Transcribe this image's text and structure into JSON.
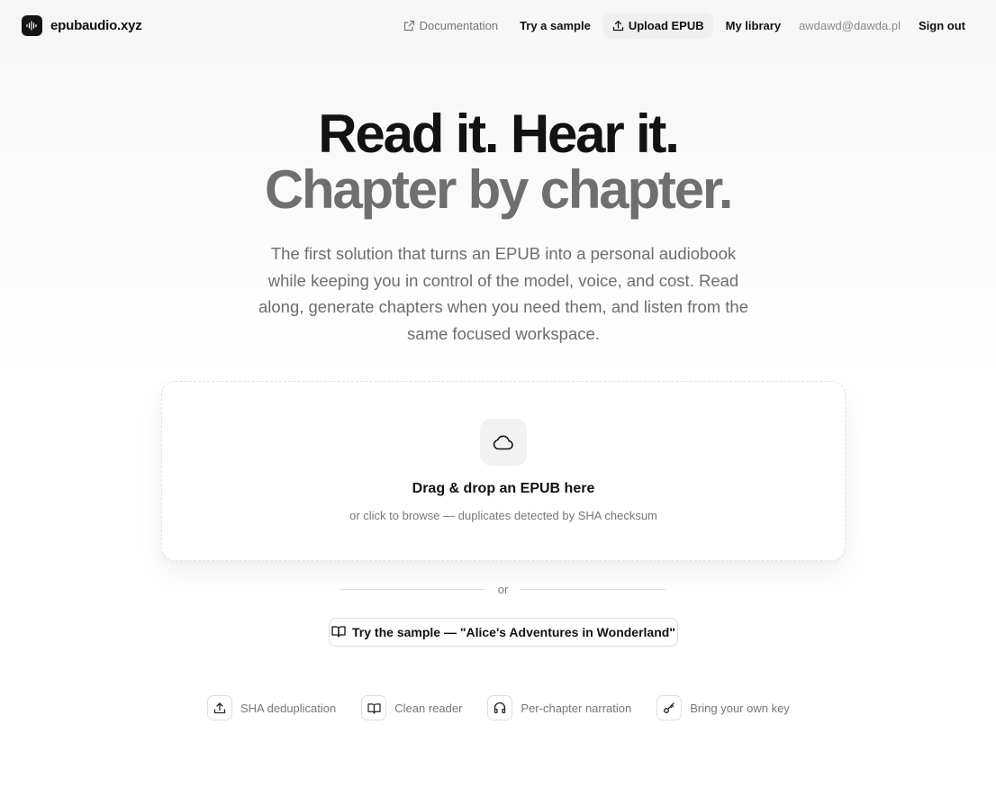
{
  "brand": {
    "name": "epubaudio.xyz",
    "logo_icon": "audio-waveform-icon"
  },
  "nav": {
    "documentation": {
      "label": "Documentation",
      "icon": "external-link-icon"
    },
    "try_sample": {
      "label": "Try a sample"
    },
    "upload": {
      "label": "Upload EPUB",
      "icon": "upload-icon"
    },
    "library": {
      "label": "My library"
    },
    "user_email": "awdawd@dawda.pl",
    "sign_out": {
      "label": "Sign out"
    }
  },
  "hero": {
    "title_line1": "Read it. Hear it.",
    "title_line2": "Chapter by chapter.",
    "lead": "The first solution that turns an EPUB into a personal audiobook while keeping you in control of the model, voice, and cost. Read along, generate chapters when you need them, and listen from the same focused workspace."
  },
  "dropzone": {
    "icon": "cloud-icon",
    "title": "Drag & drop an EPUB here",
    "subtitle": "or click to browse — duplicates detected by SHA checksum"
  },
  "divider": {
    "label": "or"
  },
  "sample_button": {
    "label": "Try the sample — \"Alice's Adventures in Wonderland\"",
    "icon": "book-open-icon"
  },
  "features": [
    {
      "label": "SHA deduplication",
      "icon": "upload-icon"
    },
    {
      "label": "Clean reader",
      "icon": "book-open-icon"
    },
    {
      "label": "Per-chapter narration",
      "icon": "headphones-icon"
    },
    {
      "label": "Bring your own key",
      "icon": "key-icon"
    }
  ],
  "colors": {
    "text": "#111111",
    "muted": "#777777",
    "title_secondary": "#6f6f6f",
    "logo_bg": "#141414",
    "active_nav_bg": "#efefef"
  }
}
